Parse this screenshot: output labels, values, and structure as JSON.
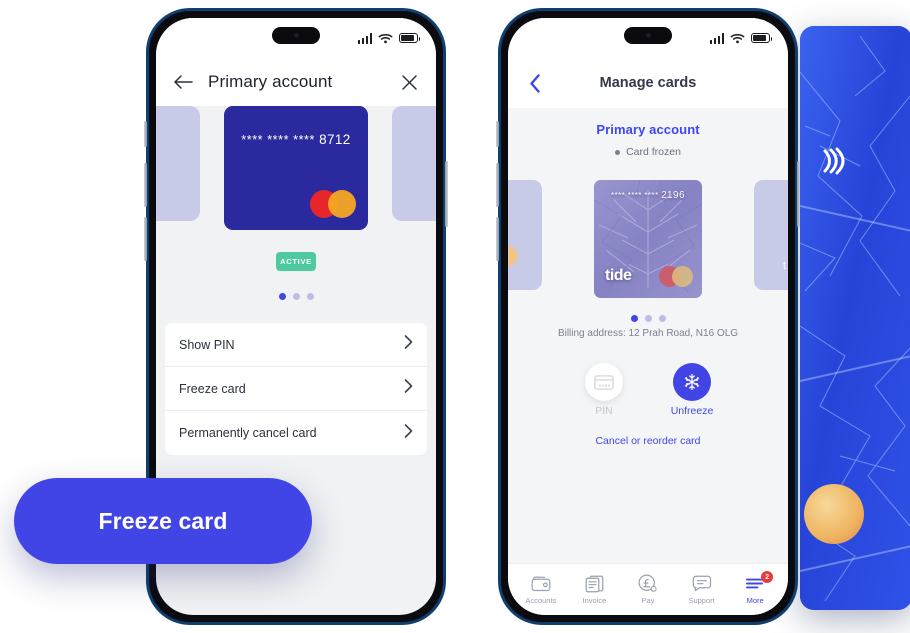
{
  "callout": {
    "label": "Freeze card"
  },
  "phone_left": {
    "status_bar": {
      "signal_icon": "signal-bars-icon",
      "wifi_icon": "wifi-icon",
      "battery_icon": "battery-icon"
    },
    "nav": {
      "back_icon": "arrow-left-icon",
      "title": "Primary account",
      "close_icon": "close-icon"
    },
    "card": {
      "masked_number": "**** **** ****",
      "last4": "8712",
      "brand_icon": "mastercard-icon"
    },
    "status_badge": "ACTIVE",
    "carousel": {
      "total": 3,
      "active_index": 0
    },
    "options": [
      {
        "label": "Show PIN",
        "chevron": "chevron-right-icon"
      },
      {
        "label": "Freeze card",
        "chevron": "chevron-right-icon"
      },
      {
        "label": "Permanently cancel card",
        "chevron": "chevron-right-icon"
      }
    ]
  },
  "phone_right": {
    "status_bar": {
      "signal_icon": "signal-bars-icon",
      "wifi_icon": "wifi-icon",
      "battery_icon": "battery-icon"
    },
    "nav": {
      "back_icon": "chevron-left-icon",
      "title": "Manage cards"
    },
    "account": {
      "name": "Primary account",
      "state": "Card frozen"
    },
    "card": {
      "masked_number": "**** **** ****",
      "last4": "2196",
      "logo": "tide",
      "brand_icon": "mastercard-icon"
    },
    "carousel": {
      "total": 3,
      "active_index": 0
    },
    "billing": "Billing address: 12 Prah Road, N16 OLG",
    "actions": [
      {
        "label": "PIN",
        "icon": "card-pin-icon",
        "enabled": false
      },
      {
        "label": "Unfreeze",
        "icon": "snowflake-icon",
        "enabled": true
      }
    ],
    "cancel_link": "Cancel or reorder card",
    "tabs": [
      {
        "label": "Accounts",
        "icon": "wallet-icon",
        "active": false,
        "badge": ""
      },
      {
        "label": "Invoice",
        "icon": "documents-icon",
        "active": false,
        "badge": ""
      },
      {
        "label": "Pay",
        "icon": "pound-circle-icon",
        "active": false,
        "badge": ""
      },
      {
        "label": "Support",
        "icon": "chat-bubble-icon",
        "active": false,
        "badge": ""
      },
      {
        "label": "More",
        "icon": "menu-lines-icon",
        "active": true,
        "badge": "2"
      }
    ]
  },
  "hero_card": {
    "contactless_icon": "contactless-icon"
  },
  "colors": {
    "accent": "#4245e6",
    "card_blue": "#2a2a9e",
    "badge_green": "#4fc99f",
    "frozen_purple": "#8e8cc6",
    "notification_red": "#e93b3b",
    "screen_bg": "#f1f2f4"
  }
}
